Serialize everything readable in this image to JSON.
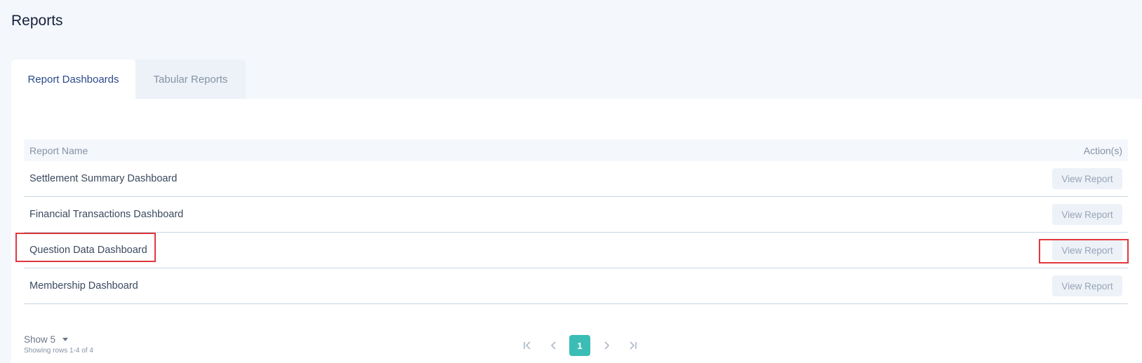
{
  "page": {
    "title": "Reports"
  },
  "tabs": [
    {
      "label": "Report Dashboards",
      "active": true
    },
    {
      "label": "Tabular Reports",
      "active": false
    }
  ],
  "table": {
    "headers": {
      "name": "Report Name",
      "actions": "Action(s)"
    },
    "rows": [
      {
        "name": "Settlement Summary Dashboard",
        "action": "View Report"
      },
      {
        "name": "Financial Transactions Dashboard",
        "action": "View Report"
      },
      {
        "name": "Question Data Dashboard",
        "action": "View Report"
      },
      {
        "name": "Membership Dashboard",
        "action": "View Report"
      }
    ]
  },
  "footer": {
    "show_label": "Show 5",
    "showing_text": "Showing rows 1-4 of 4"
  },
  "pagination": {
    "current_page": "1",
    "icons": [
      "first-page-icon",
      "prev-page-icon",
      "next-page-icon",
      "last-page-icon"
    ]
  },
  "colors": {
    "accent": "#3bbdb5",
    "highlight": "#e0383e",
    "active_tab_text": "#2c4a8a"
  }
}
